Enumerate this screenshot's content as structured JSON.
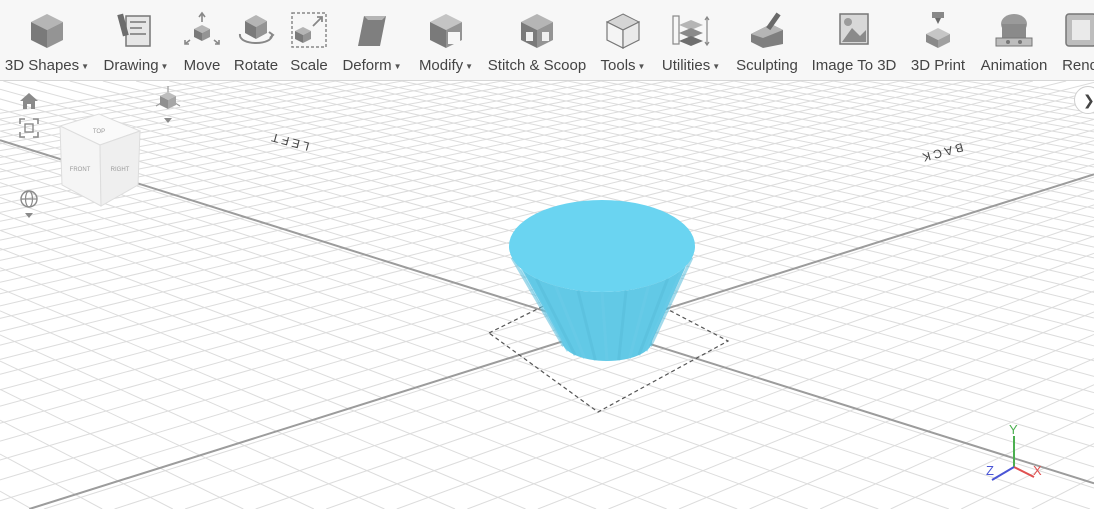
{
  "toolbar": {
    "items": [
      {
        "label": "3D Shapes",
        "icon": "cube-icon",
        "has_dropdown": true
      },
      {
        "label": "Drawing",
        "icon": "drawing-icon",
        "has_dropdown": true
      },
      {
        "label": "Move",
        "icon": "move-icon",
        "has_dropdown": false
      },
      {
        "label": "Rotate",
        "icon": "rotate-icon",
        "has_dropdown": false
      },
      {
        "label": "Scale",
        "icon": "scale-icon",
        "has_dropdown": false
      },
      {
        "label": "Deform",
        "icon": "deform-icon",
        "has_dropdown": true
      },
      {
        "label": "Modify",
        "icon": "modify-icon",
        "has_dropdown": true
      },
      {
        "label": "Stitch & Scoop",
        "icon": "stitch-scoop-icon",
        "has_dropdown": false
      },
      {
        "label": "Tools",
        "icon": "tools-icon",
        "has_dropdown": true
      },
      {
        "label": "Utilities",
        "icon": "utilities-icon",
        "has_dropdown": true
      },
      {
        "label": "Sculpting",
        "icon": "sculpting-icon",
        "has_dropdown": false
      },
      {
        "label": "Image To 3D",
        "icon": "image-to-3d-icon",
        "has_dropdown": false
      },
      {
        "label": "3D Print",
        "icon": "3d-print-icon",
        "has_dropdown": false
      },
      {
        "label": "Animation",
        "icon": "animation-icon",
        "has_dropdown": false
      },
      {
        "label": "Rend",
        "icon": "render-icon",
        "has_dropdown": false
      }
    ]
  },
  "viewport": {
    "grid_labels": {
      "left": "LEFT",
      "back": "BACK"
    },
    "view_cube": {
      "top": "TOP",
      "front": "FRONT",
      "right": "RIGHT"
    },
    "axes": {
      "x": "X",
      "y": "Y",
      "z": "Z"
    },
    "object": {
      "shape": "truncated-cone",
      "color": "#6ad4f1"
    }
  },
  "colors": {
    "toolbar_bg": "#f7f7f7",
    "icon_gray": "#777777",
    "grid_line": "#dadada",
    "axis_line": "#9a9a9a",
    "axis_x": "#e05050",
    "axis_y": "#4caf50",
    "axis_z": "#4a55d6"
  }
}
